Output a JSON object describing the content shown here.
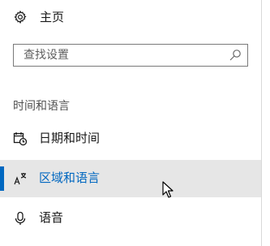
{
  "home": {
    "label": "主页",
    "icon": "gear-icon"
  },
  "search": {
    "placeholder": "查找设置",
    "value": "",
    "icon": "search-icon"
  },
  "section": {
    "header": "时间和语言"
  },
  "nav": {
    "items": [
      {
        "label": "日期和时间",
        "icon": "calendar-clock-icon",
        "selected": false
      },
      {
        "label": "区域和语言",
        "icon": "region-language-icon",
        "selected": true
      },
      {
        "label": "语音",
        "icon": "microphone-icon",
        "selected": false
      }
    ]
  },
  "colors": {
    "accent": "#0067c0",
    "selected_bg": "#e6e6e6",
    "text": "#1a1a1a",
    "muted_text": "#505050",
    "border": "#7a7a7a"
  }
}
